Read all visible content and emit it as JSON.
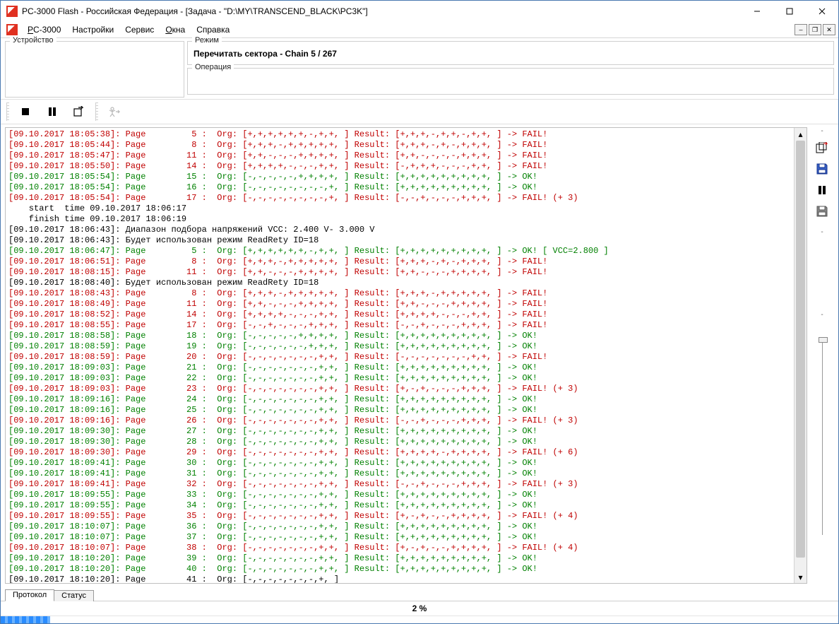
{
  "window": {
    "title": "PC-3000 Flash  - Российская Федерация - [Задача - \"D:\\MY\\TRANSCEND_BLACK\\PC3K\"]"
  },
  "menu": {
    "items": [
      "PC-3000",
      "Настройки",
      "Сервис",
      "Окна",
      "Справка"
    ],
    "underline_idx": [
      0,
      null,
      null,
      0,
      null
    ]
  },
  "panels": {
    "device_label": "Устройство",
    "mode_label": "Режим",
    "mode_value": "Перечитать сектора - Chain 5 / 267",
    "op_label": "Операция"
  },
  "tabs": {
    "protocol": "Протокол",
    "status": "Статус",
    "active": "protocol"
  },
  "status": {
    "percent_text": "2 %",
    "percent_value": 2
  },
  "sidebar": {
    "tick1": "-",
    "tick2": "-",
    "tick3": "-"
  },
  "log": [
    {
      "c": "red",
      "t": "[09.10.2017 18:05:38]: Page         5 :  Org: [+,+,+,+,+,+,-,+,+, ] Result: [+,+,+,-,+,+,-,+,+, ] -> FAIL!"
    },
    {
      "c": "red",
      "t": "[09.10.2017 18:05:44]: Page         8 :  Org: [+,+,+,-,+,+,+,+,+, ] Result: [+,+,+,-,+,-,+,+,+, ] -> FAIL!"
    },
    {
      "c": "red",
      "t": "[09.10.2017 18:05:47]: Page        11 :  Org: [+,+,-,-,-,+,+,+,+, ] Result: [+,+,-,-,-,-,+,+,+, ] -> FAIL!"
    },
    {
      "c": "red",
      "t": "[09.10.2017 18:05:50]: Page        14 :  Org: [+,+,+,+,-,-,-,+,+, ] Result: [-,+,+,+,-,-,-,+,+, ] -> FAIL!"
    },
    {
      "c": "green",
      "t": "[09.10.2017 18:05:54]: Page        15 :  Org: [-,-,-,-,-,+,+,+,+, ] Result: [+,+,+,+,+,+,+,+,+, ] -> OK!"
    },
    {
      "c": "green",
      "t": "[09.10.2017 18:05:54]: Page        16 :  Org: [-,-,-,-,-,-,-,-,+, ] Result: [+,+,+,+,+,+,+,+,+, ] -> OK!"
    },
    {
      "c": "red",
      "t": "[09.10.2017 18:05:54]: Page        17 :  Org: [-,-,-,-,-,-,-,-,+, ] Result: [-,-,+,-,-,-,+,+,+, ] -> FAIL! (+ 3)"
    },
    {
      "c": "blk",
      "t": "    start  time 09.10.2017 18:06:17"
    },
    {
      "c": "blk",
      "t": "    finish time 09.10.2017 18:06:19"
    },
    {
      "c": "blk",
      "t": "[09.10.2017 18:06:43]: Диапазон подбора напряжений VCC: 2.400 V- 3.000 V"
    },
    {
      "c": "blk",
      "t": "[09.10.2017 18:06:43]: Будет использован режим ReadRety ID=18"
    },
    {
      "c": "green",
      "t": "[09.10.2017 18:06:47]: Page         5 :  Org: [+,+,+,+,+,+,-,+,+, ] Result: [+,+,+,+,+,+,+,+,+, ] -> OK! [ VCC=2.800 ]"
    },
    {
      "c": "red",
      "t": "[09.10.2017 18:06:51]: Page         8 :  Org: [+,+,+,-,+,+,+,+,+, ] Result: [+,+,+,-,+,-,+,+,+, ] -> FAIL!"
    },
    {
      "c": "red",
      "t": "[09.10.2017 18:08:15]: Page        11 :  Org: [+,+,-,-,-,+,+,+,+, ] Result: [+,+,-,-,-,+,+,+,+, ] -> FAIL!"
    },
    {
      "c": "blk",
      "t": "[09.10.2017 18:08:40]: Будет использован режим ReadRety ID=18"
    },
    {
      "c": "red",
      "t": "[09.10.2017 18:08:43]: Page         8 :  Org: [+,+,+,-,+,+,+,+,+, ] Result: [+,+,+,-,+,+,+,+,+, ] -> FAIL!"
    },
    {
      "c": "red",
      "t": "[09.10.2017 18:08:49]: Page        11 :  Org: [+,+,-,-,-,+,+,+,+, ] Result: [+,+,-,-,-,+,+,+,+, ] -> FAIL!"
    },
    {
      "c": "red",
      "t": "[09.10.2017 18:08:52]: Page        14 :  Org: [+,+,+,+,-,-,-,+,+, ] Result: [+,+,+,+,-,-,-,+,+, ] -> FAIL!"
    },
    {
      "c": "red",
      "t": "[09.10.2017 18:08:55]: Page        17 :  Org: [-,-,+,-,-,-,+,+,+, ] Result: [-,-,+,-,-,-,+,+,+, ] -> FAIL!"
    },
    {
      "c": "green",
      "t": "[09.10.2017 18:08:58]: Page        18 :  Org: [-,-,-,-,-,+,+,+,+, ] Result: [+,+,+,+,+,+,+,+,+, ] -> OK!"
    },
    {
      "c": "green",
      "t": "[09.10.2017 18:08:59]: Page        19 :  Org: [-,-,-,-,-,-,+,+,+, ] Result: [+,+,+,+,+,+,+,+,+, ] -> OK!"
    },
    {
      "c": "red",
      "t": "[09.10.2017 18:08:59]: Page        20 :  Org: [-,-,-,-,-,-,-,+,+, ] Result: [-,-,-,-,-,-,-,+,+, ] -> FAIL!"
    },
    {
      "c": "green",
      "t": "[09.10.2017 18:09:03]: Page        21 :  Org: [-,-,-,-,-,-,-,+,+, ] Result: [+,+,+,+,+,+,+,+,+, ] -> OK!"
    },
    {
      "c": "green",
      "t": "[09.10.2017 18:09:03]: Page        22 :  Org: [-,-,-,-,-,-,-,+,+, ] Result: [+,+,+,+,+,+,+,+,+, ] -> OK!"
    },
    {
      "c": "red",
      "t": "[09.10.2017 18:09:03]: Page        23 :  Org: [-,-,-,-,-,-,-,+,+, ] Result: [+,-,+,-,-,-,+,+,+, ] -> FAIL! (+ 3)"
    },
    {
      "c": "green",
      "t": "[09.10.2017 18:09:16]: Page        24 :  Org: [-,-,-,-,-,-,-,+,+, ] Result: [+,+,+,+,+,+,+,+,+, ] -> OK!"
    },
    {
      "c": "green",
      "t": "[09.10.2017 18:09:16]: Page        25 :  Org: [-,-,-,-,-,-,-,+,+, ] Result: [+,+,+,+,+,+,+,+,+, ] -> OK!"
    },
    {
      "c": "red",
      "t": "[09.10.2017 18:09:16]: Page        26 :  Org: [-,-,-,-,-,-,-,+,+, ] Result: [-,-,+,-,-,-,+,+,+, ] -> FAIL! (+ 3)"
    },
    {
      "c": "green",
      "t": "[09.10.2017 18:09:30]: Page        27 :  Org: [-,-,-,-,-,-,-,+,+, ] Result: [+,+,+,+,+,+,+,+,+, ] -> OK!"
    },
    {
      "c": "green",
      "t": "[09.10.2017 18:09:30]: Page        28 :  Org: [-,-,-,-,-,-,-,+,+, ] Result: [+,+,+,+,+,+,+,+,+, ] -> OK!"
    },
    {
      "c": "red",
      "t": "[09.10.2017 18:09:30]: Page        29 :  Org: [-,-,-,-,-,-,-,+,+, ] Result: [+,+,+,+,-,+,+,+,+, ] -> FAIL! (+ 6)"
    },
    {
      "c": "green",
      "t": "[09.10.2017 18:09:41]: Page        30 :  Org: [-,-,-,-,-,-,-,+,+, ] Result: [+,+,+,+,+,+,+,+,+, ] -> OK!"
    },
    {
      "c": "green",
      "t": "[09.10.2017 18:09:41]: Page        31 :  Org: [-,-,-,-,-,-,-,+,+, ] Result: [+,+,+,+,+,+,+,+,+, ] -> OK!"
    },
    {
      "c": "red",
      "t": "[09.10.2017 18:09:41]: Page        32 :  Org: [-,-,-,-,-,-,-,+,+, ] Result: [-,-,+,-,-,-,+,+,+, ] -> FAIL! (+ 3)"
    },
    {
      "c": "green",
      "t": "[09.10.2017 18:09:55]: Page        33 :  Org: [-,-,-,-,-,-,-,+,+, ] Result: [+,+,+,+,+,+,+,+,+, ] -> OK!"
    },
    {
      "c": "green",
      "t": "[09.10.2017 18:09:55]: Page        34 :  Org: [-,-,-,-,-,-,-,+,+, ] Result: [+,+,+,+,+,+,+,+,+, ] -> OK!"
    },
    {
      "c": "red",
      "t": "[09.10.2017 18:09:55]: Page        35 :  Org: [-,-,-,-,-,-,-,+,+, ] Result: [+,-,+,-,-,+,+,+,+, ] -> FAIL! (+ 4)"
    },
    {
      "c": "green",
      "t": "[09.10.2017 18:10:07]: Page        36 :  Org: [-,-,-,-,-,-,-,+,+, ] Result: [+,+,+,+,+,+,+,+,+, ] -> OK!"
    },
    {
      "c": "green",
      "t": "[09.10.2017 18:10:07]: Page        37 :  Org: [-,-,-,-,-,-,-,+,+, ] Result: [+,+,+,+,+,+,+,+,+, ] -> OK!"
    },
    {
      "c": "red",
      "t": "[09.10.2017 18:10:07]: Page        38 :  Org: [-,-,-,-,-,-,-,+,+, ] Result: [+,-,+,-,-,+,+,+,+, ] -> FAIL! (+ 4)"
    },
    {
      "c": "green",
      "t": "[09.10.2017 18:10:20]: Page        39 :  Org: [-,-,-,-,-,-,-,+,+, ] Result: [+,+,+,+,+,+,+,+,+, ] -> OK!"
    },
    {
      "c": "green",
      "t": "[09.10.2017 18:10:20]: Page        40 :  Org: [-,-,-,-,-,-,-,+,+, ] Result: [+,+,+,+,+,+,+,+,+, ] -> OK!"
    },
    {
      "c": "blk",
      "t": "[09.10.2017 18:10:20]: Page        41 :  Org: [-,-,-,-,-,-,-,+, ]"
    }
  ]
}
